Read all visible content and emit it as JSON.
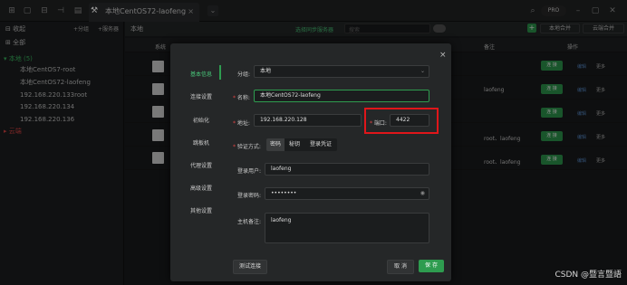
{
  "topbar": {
    "tab_title": "本地CentOS72-laofeng",
    "tab_close": "×",
    "tab_more": "⌄",
    "pro_label": "PRO"
  },
  "sidebar": {
    "favorites": "收起",
    "all": "全部",
    "btn_group": "+分组",
    "btn_server": "+服务器",
    "group_local": "本地 (5)",
    "items": [
      "本地CentOS7-root",
      "本地CentOS72-laofeng",
      "192.168.220.133root",
      "192.168.220.134",
      "192.168.220.136"
    ],
    "group_cloud": "云端"
  },
  "subbar": {
    "title": "本地",
    "link": "选择同步服务器",
    "search_placeholder": "搜索",
    "btn_local": "本地合并",
    "btn_cloud": "云端合并"
  },
  "table": {
    "col_system": "系统",
    "col_note": "备注",
    "col_actions": "操作",
    "rows": [
      {
        "note": "",
        "connect": "连 接",
        "edit": "编辑",
        "more": "更多"
      },
      {
        "note": "laofeng",
        "connect": "连 接",
        "edit": "编辑",
        "more": "更多"
      },
      {
        "note": "",
        "connect": "连 接",
        "edit": "编辑",
        "more": "更多"
      },
      {
        "note": "root、laofeng",
        "connect": "连 接",
        "edit": "编辑",
        "more": "更多"
      },
      {
        "note": "root、laofeng",
        "connect": "连 接",
        "edit": "编辑",
        "more": "更多"
      }
    ]
  },
  "modal": {
    "close": "×",
    "nav": [
      "基本信息",
      "连接设置",
      "初始化",
      "跳板机",
      "代理设置",
      "高级设置",
      "其他设置"
    ],
    "group_label": "分组:",
    "group_value": "本地",
    "name_label": "名称:",
    "name_value": "本地CentOS72-laofeng",
    "host_label": "地址:",
    "host_value": "192.168.220.128",
    "port_label": "端口:",
    "port_value": "4422",
    "auth_label": "验证方式:",
    "auth_options": [
      "密码",
      "秘钥",
      "登录凭证"
    ],
    "user_label": "登录用户:",
    "user_value": "laofeng",
    "pass_label": "登录密码:",
    "pass_value": "••••••••",
    "note_label": "主机备注:",
    "note_value": "laofeng",
    "test_btn": "测试连接",
    "cancel_btn": "取 消",
    "save_btn": "保 存"
  },
  "watermark": "CSDN @暨言暨語"
}
